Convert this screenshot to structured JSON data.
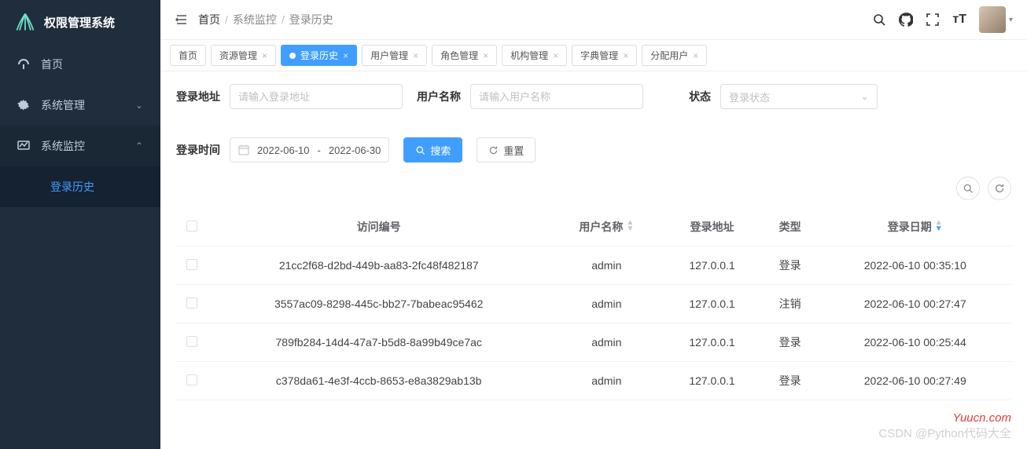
{
  "brand": {
    "title": "权限管理系统"
  },
  "sidebar": {
    "items": [
      {
        "label": "首页"
      },
      {
        "label": "系统管理"
      },
      {
        "label": "系统监控"
      },
      {
        "label": "登录历史"
      }
    ]
  },
  "breadcrumbs": {
    "a": "首页",
    "b": "系统监控",
    "c": "登录历史"
  },
  "tabs": [
    {
      "label": "首页",
      "closable": false,
      "active": false
    },
    {
      "label": "资源管理",
      "closable": true,
      "active": false
    },
    {
      "label": "登录历史",
      "closable": true,
      "active": true
    },
    {
      "label": "用户管理",
      "closable": true,
      "active": false
    },
    {
      "label": "角色管理",
      "closable": true,
      "active": false
    },
    {
      "label": "机构管理",
      "closable": true,
      "active": false
    },
    {
      "label": "字典管理",
      "closable": true,
      "active": false
    },
    {
      "label": "分配用户",
      "closable": true,
      "active": false
    }
  ],
  "filters": {
    "addr_label": "登录地址",
    "addr_placeholder": "请输入登录地址",
    "user_label": "用户名称",
    "user_placeholder": "请输入用户名称",
    "status_label": "状态",
    "status_placeholder": "登录状态",
    "time_label": "登录时间",
    "date_start": "2022-06-10",
    "date_sep": "-",
    "date_end": "2022-06-30",
    "search_label": "搜索",
    "reset_label": "重置"
  },
  "table": {
    "headers": {
      "id": "访问编号",
      "user": "用户名称",
      "addr": "登录地址",
      "type": "类型",
      "date": "登录日期"
    },
    "rows": [
      {
        "id": "21cc2f68-d2bd-449b-aa83-2fc48f482187",
        "user": "admin",
        "addr": "127.0.0.1",
        "type": "登录",
        "date": "2022-06-10 00:35:10"
      },
      {
        "id": "3557ac09-8298-445c-bb27-7babeac95462",
        "user": "admin",
        "addr": "127.0.0.1",
        "type": "注销",
        "date": "2022-06-10 00:27:47"
      },
      {
        "id": "789fb284-14d4-47a7-b5d8-8a99b49ce7ac",
        "user": "admin",
        "addr": "127.0.0.1",
        "type": "登录",
        "date": "2022-06-10 00:25:44"
      },
      {
        "id": "c378da61-4e3f-4ccb-8653-e8a3829ab13b",
        "user": "admin",
        "addr": "127.0.0.1",
        "type": "登录",
        "date": "2022-06-10 00:27:49"
      }
    ]
  },
  "watermark": {
    "line1": "Yuucn.com",
    "line2": "CSDN @Python代码大全"
  }
}
